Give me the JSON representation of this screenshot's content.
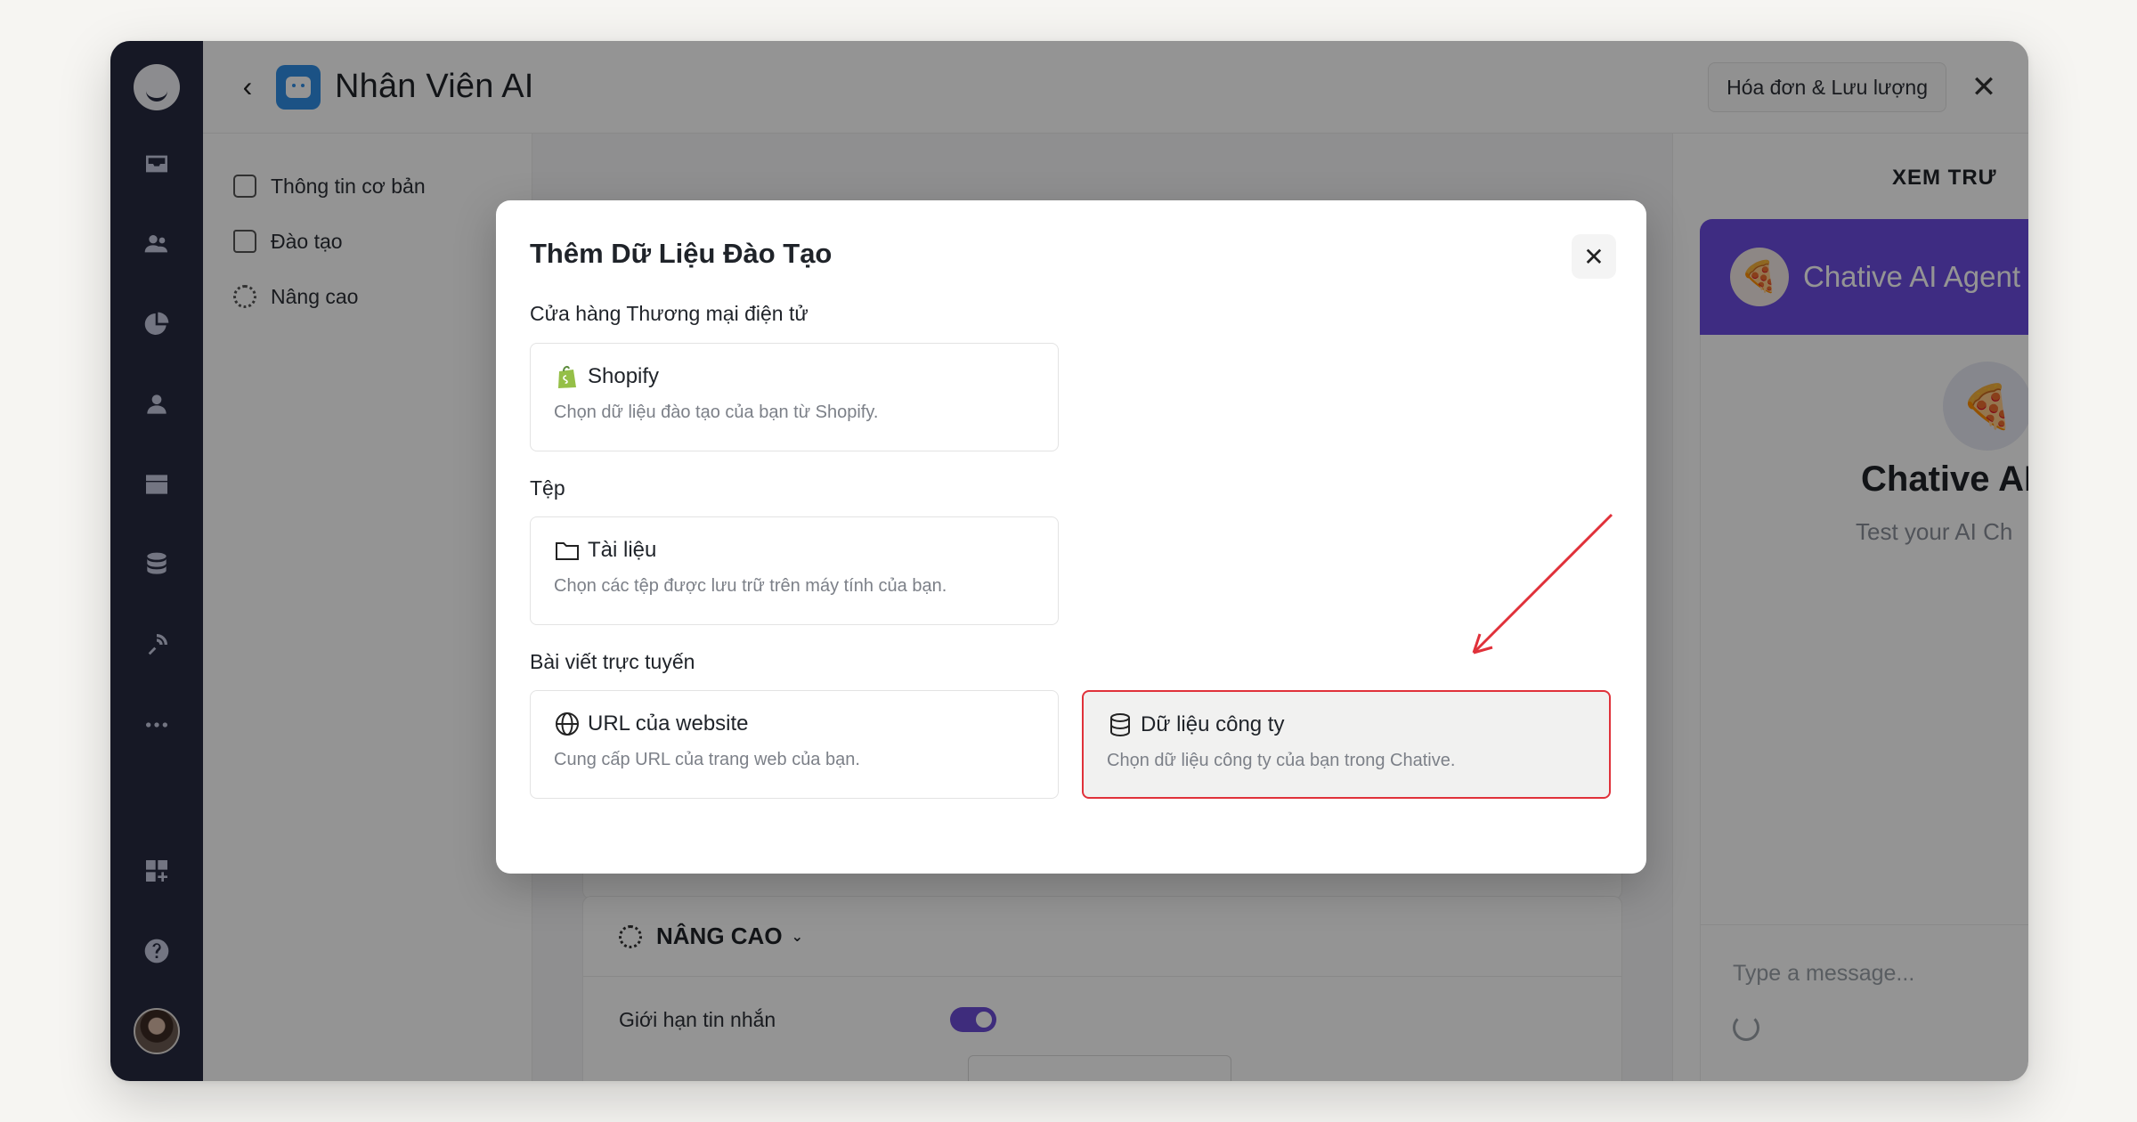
{
  "window": {
    "title": "Nhân Viên AI",
    "billing_button": "Hóa đơn & Lưu lượng"
  },
  "sidenav": {
    "items": [
      {
        "label": "Thông tin cơ bản",
        "icon": "robot-icon"
      },
      {
        "label": "Đào tạo",
        "icon": "folder-icon"
      },
      {
        "label": "Nâng cao",
        "icon": "gear-icon"
      }
    ]
  },
  "advanced": {
    "header": "NÂNG CAO",
    "message_limit_label": "Giới hạn tin nhắn",
    "toggle_on": true
  },
  "preview": {
    "title": "XEM TRƯ",
    "agent_name": "Chative AI Agent",
    "chat_title": "Chative AI",
    "chat_subtitle": "Test your AI Ch",
    "input_placeholder": "Type a message..."
  },
  "modal": {
    "title": "Thêm Dữ Liệu Đào Tạo",
    "sections": [
      {
        "label": "Cửa hàng Thương mại điện tử",
        "options": [
          {
            "title": "Shopify",
            "desc": "Chọn dữ liệu đào tạo của bạn từ Shopify.",
            "icon": "shopify-icon"
          }
        ]
      },
      {
        "label": "Tệp",
        "options": [
          {
            "title": "Tài liệu",
            "desc": "Chọn các tệp được lưu trữ trên máy tính của bạn.",
            "icon": "folder-icon"
          }
        ]
      },
      {
        "label": "Bài viết trực tuyến",
        "options": [
          {
            "title": "URL của website",
            "desc": "Cung cấp URL của trang web của bạn.",
            "icon": "globe-icon"
          },
          {
            "title": "Dữ liệu công ty",
            "desc": "Chọn dữ liệu công ty của bạn trong Chative.",
            "icon": "database-icon"
          }
        ]
      }
    ]
  },
  "colors": {
    "rail": "#262a40",
    "accent_purple": "#6b4de0",
    "highlight_border": "#e0313a",
    "agent_badge": "#2f8ee6"
  }
}
